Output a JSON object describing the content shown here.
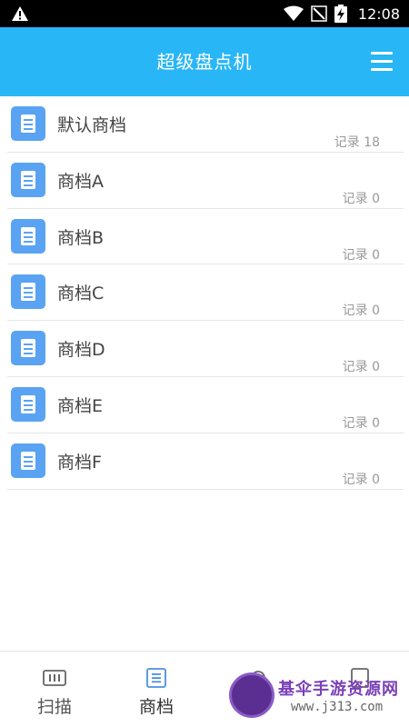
{
  "status_bar": {
    "time": "12:08",
    "icons": [
      "warning-icon",
      "wifi-icon",
      "no-signal-icon",
      "battery-charging-icon"
    ]
  },
  "app_bar": {
    "title": "超级盘点机",
    "menu_icon": "menu-icon"
  },
  "list": {
    "items": [
      {
        "name": "默认商档",
        "count": "记录 18"
      },
      {
        "name": "商档A",
        "count": "记录 0"
      },
      {
        "name": "商档B",
        "count": "记录 0"
      },
      {
        "name": "商档C",
        "count": "记录 0"
      },
      {
        "name": "商档D",
        "count": "记录 0"
      },
      {
        "name": "商档E",
        "count": "记录 0"
      },
      {
        "name": "商档F",
        "count": "记录 0"
      }
    ]
  },
  "bottom_nav": {
    "items": [
      {
        "label": "扫描",
        "icon": "barcode-icon"
      },
      {
        "label": "商档",
        "icon": "list-icon"
      },
      {
        "label": "",
        "icon": "gear-icon"
      },
      {
        "label": "",
        "icon": "square-icon"
      }
    ]
  },
  "watermark": {
    "text": "基伞手游资源网",
    "url": "www.j313.com"
  },
  "colors": {
    "accent": "#29b6f6",
    "doc_icon": "#5aa3f2",
    "active_nav": "#4a90e2"
  }
}
